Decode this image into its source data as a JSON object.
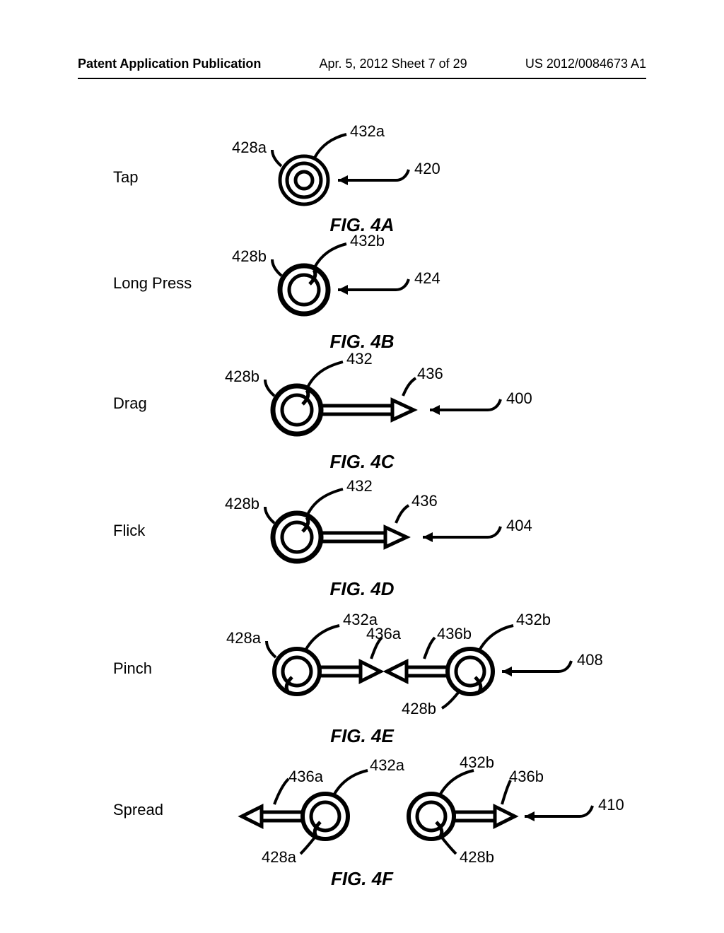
{
  "header": {
    "left": "Patent Application Publication",
    "center": "Apr. 5, 2012  Sheet 7 of 29",
    "right": "US 2012/0084673 A1"
  },
  "figs": {
    "a": {
      "label": "Tap",
      "cap": "FIG. 4A",
      "refs": {
        "r432a": "432a",
        "r428a": "428a",
        "r420": "420"
      }
    },
    "b": {
      "label": "Long Press",
      "cap": "FIG. 4B",
      "refs": {
        "r432b": "432b",
        "r428b": "428b",
        "r424": "424"
      }
    },
    "c": {
      "label": "Drag",
      "cap": "FIG. 4C",
      "refs": {
        "r432": "432",
        "r436": "436",
        "r428b": "428b",
        "r400": "400"
      }
    },
    "d": {
      "label": "Flick",
      "cap": "FIG. 4D",
      "refs": {
        "r432": "432",
        "r436": "436",
        "r428b": "428b",
        "r404": "404"
      }
    },
    "e": {
      "label": "Pinch",
      "cap": "FIG. 4E",
      "refs": {
        "r432a": "432a",
        "r432b": "432b",
        "r436a": "436a",
        "r436b": "436b",
        "r428a": "428a",
        "r428b": "428b",
        "r408": "408"
      }
    },
    "f": {
      "label": "Spread",
      "cap": "FIG. 4F",
      "refs": {
        "r432a": "432a",
        "r432b": "432b",
        "r436a": "436a",
        "r436b": "436b",
        "r428a": "428a",
        "r428b": "428b",
        "r410": "410"
      }
    }
  }
}
